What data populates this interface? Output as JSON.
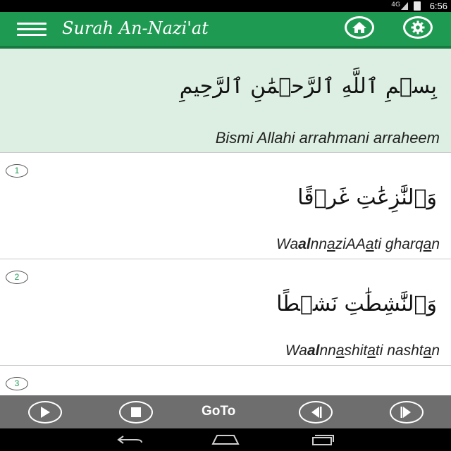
{
  "status_bar": {
    "network": "4G",
    "time": "6:56"
  },
  "app_bar": {
    "title": "Surah An-Nazi'at",
    "menu_icon": "hamburger-menu-icon",
    "home_icon": "home-icon",
    "settings_icon": "gear-icon",
    "background": "#1f9a52"
  },
  "bismillah": {
    "arabic": "بِسۡمِ ٱللَّهِ ٱلرَّحۡمَٰنِ ٱلرَّحِيمِ",
    "transliteration": "Bismi Allahi arrahmani arraheem",
    "background": "#dcefe2"
  },
  "verses": [
    {
      "number": "1",
      "arabic": "وَٱلنَّٰزِعَٰتِ غَرۡقًا",
      "translit": [
        {
          "t": "Wa",
          "b": false,
          "u": false
        },
        {
          "t": "al",
          "b": true,
          "u": false
        },
        {
          "t": "nn",
          "b": false,
          "u": false
        },
        {
          "t": "a",
          "b": false,
          "u": true
        },
        {
          "t": "ziAA",
          "b": false,
          "u": false
        },
        {
          "t": "a",
          "b": false,
          "u": true
        },
        {
          "t": "ti gharq",
          "b": false,
          "u": false
        },
        {
          "t": "a",
          "b": false,
          "u": true
        },
        {
          "t": "n",
          "b": false,
          "u": false
        }
      ]
    },
    {
      "number": "2",
      "arabic": "وَٱلنَّٰشِطَٰتِ نَشۡطًا",
      "translit": [
        {
          "t": "Wa",
          "b": false,
          "u": false
        },
        {
          "t": "al",
          "b": true,
          "u": false
        },
        {
          "t": "nn",
          "b": false,
          "u": false
        },
        {
          "t": "a",
          "b": false,
          "u": true
        },
        {
          "t": "shit",
          "b": false,
          "u": false
        },
        {
          "t": "a",
          "b": false,
          "u": true
        },
        {
          "t": "ti nasht",
          "b": false,
          "u": false
        },
        {
          "t": "a",
          "b": false,
          "u": true
        },
        {
          "t": "n",
          "b": false,
          "u": false
        }
      ]
    },
    {
      "number": "3",
      "arabic": "",
      "translit": []
    }
  ],
  "player": {
    "play_icon": "play-icon",
    "stop_icon": "stop-icon",
    "goto_label": "GoTo",
    "prev_icon": "previous-track-icon",
    "next_icon": "next-track-icon",
    "background": "#6e6e6e"
  },
  "nav_bar": {
    "back_icon": "back-icon",
    "home_icon": "nav-home-icon",
    "recents_icon": "recents-icon"
  },
  "colors": {
    "accent": "#1f9a52",
    "verse_number": "#1f9a52"
  }
}
